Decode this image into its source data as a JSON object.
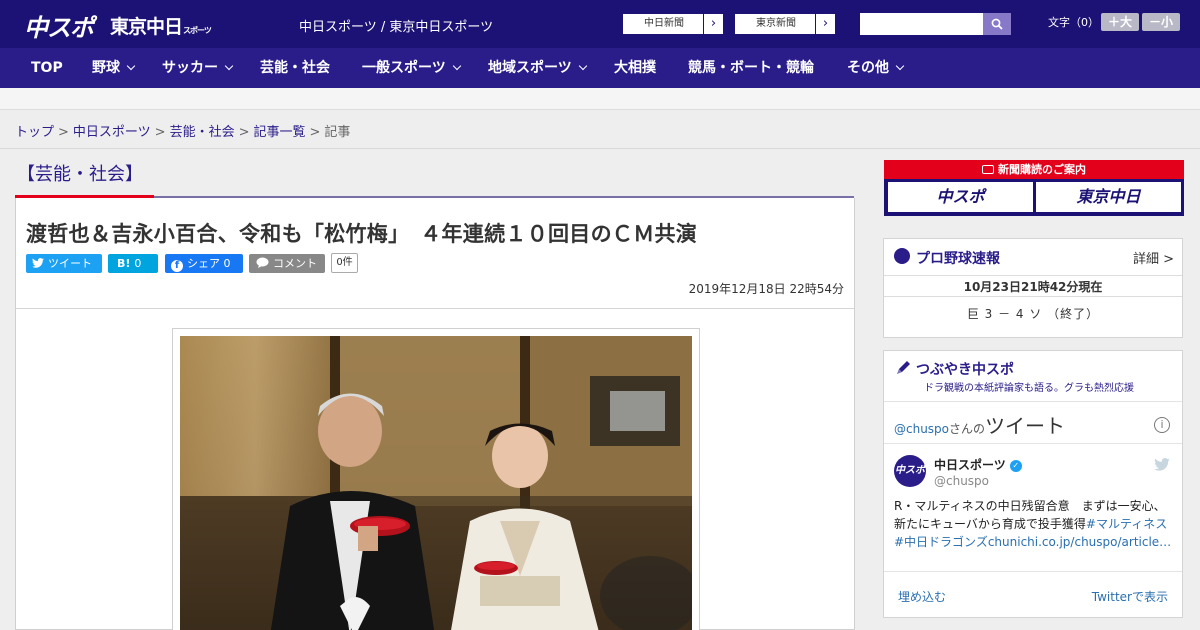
{
  "header": {
    "logo_chuspo": "中スポ",
    "logo_tokyo": "東京中日",
    "logo_tokyo_small": "スポーツ",
    "site_name": "中日スポーツ / 東京中日スポーツ",
    "ext_links": [
      "中日新聞",
      "東京新聞"
    ],
    "search_placeholder": "",
    "font_size_label": "文字（0）",
    "font_larger": "＋大",
    "font_smaller": "－小"
  },
  "nav": [
    {
      "label": "TOP",
      "has_menu": false
    },
    {
      "label": "野球",
      "has_menu": true
    },
    {
      "label": "サッカー",
      "has_menu": true
    },
    {
      "label": "芸能・社会",
      "has_menu": false
    },
    {
      "label": "一般スポーツ",
      "has_menu": true
    },
    {
      "label": "地域スポーツ",
      "has_menu": true
    },
    {
      "label": "大相撲",
      "has_menu": false
    },
    {
      "label": "競馬・ボート・競輪",
      "has_menu": false
    },
    {
      "label": "その他",
      "has_menu": true
    }
  ],
  "breadcrumb": {
    "links": [
      "トップ",
      "中日スポーツ",
      "芸能・社会",
      "記事一覧"
    ],
    "current": "記事",
    "separator": ">"
  },
  "category": "【芸能・社会】",
  "article": {
    "headline": "渡哲也＆吉永小百合、令和も「松竹梅」　４年連続１０回目のＣＭ共演",
    "share": {
      "tweet": "ツイート",
      "hatena": "B!",
      "hatena_count": "0",
      "facebook": "シェア",
      "facebook_count": "0",
      "comment": "コメント",
      "comment_count": "0件"
    },
    "date": "2019年12月18日 22時54分"
  },
  "sidebar": {
    "subscribe": {
      "title": "新聞購読のご案内",
      "buttons": [
        "中スポ",
        "東京中日"
      ]
    },
    "baseball": {
      "title": "プロ野球速報",
      "detail": "詳細 >",
      "time": "10月23日21時42分現在",
      "score": "巨 3 － 4 ソ （終了）"
    },
    "twitter": {
      "title": "つぶやき中スポ",
      "subtitle": "ドラ観戦の本紙評論家も語る。グラも熱烈応援",
      "handle_prefix": "@chuspo",
      "handle_suffix": "さんの",
      "handle_big": "ツイート",
      "info": "i",
      "avatar": "中スポ",
      "name": "中日スポーツ",
      "verified": "✓",
      "at": "@chuspo",
      "body_text": "R・マルティネスの中日残留合意　まずは一安心、新たにキューバから育成で投手獲得",
      "tags": [
        "#マルティネス",
        "#中日ドラゴンズ"
      ],
      "link": "chunichi.co.jp/chuspo/article…",
      "embed": "埋め込む",
      "view": "Twitterで表示"
    }
  },
  "colors": {
    "header_bg": "#1c1275",
    "nav_bg": "#2a1d8a",
    "accent_red": "#e2001a",
    "twitter_blue": "#1da1f2",
    "facebook_blue": "#1877f2",
    "hatena_blue": "#00a4de",
    "comment_gray": "#888888"
  }
}
